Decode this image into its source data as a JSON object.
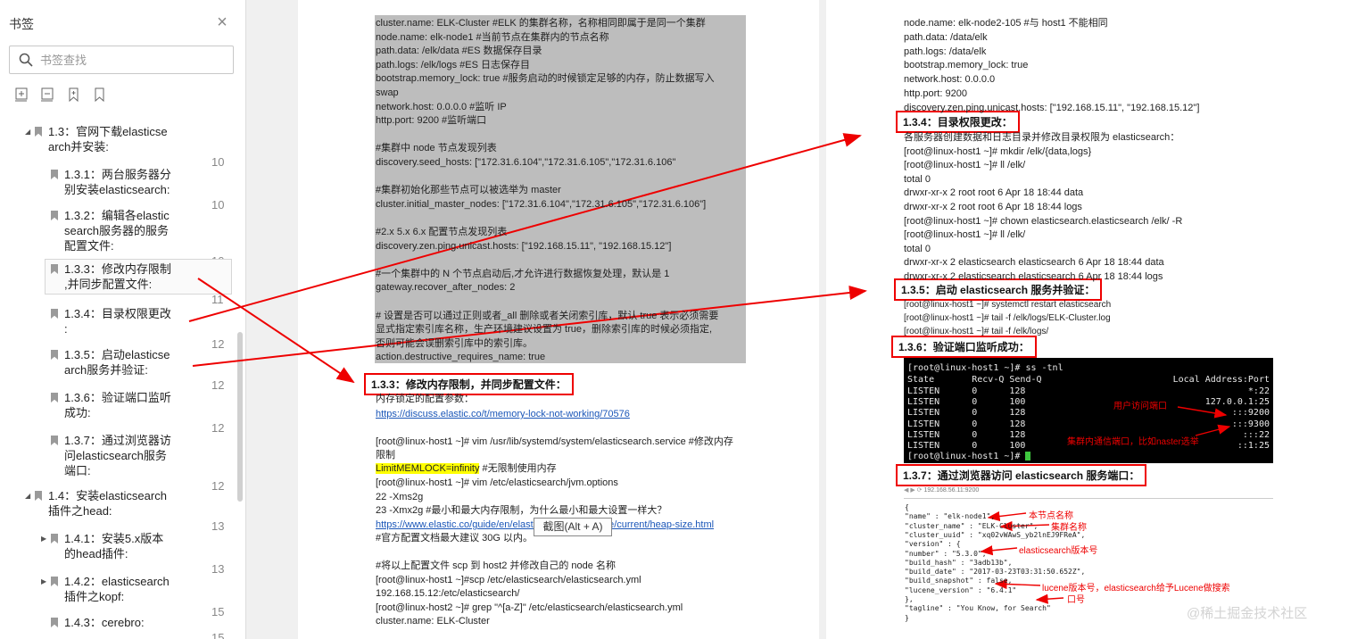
{
  "sidebar": {
    "title": "书签",
    "close_icon": "close-icon",
    "search_placeholder": "书签查找",
    "toolbar_icons": [
      "expand-all-icon",
      "collapse-all-icon",
      "add-bookmark-icon",
      "bookmark-icon"
    ],
    "items": [
      {
        "level": 1,
        "expanded": true,
        "label_lines": [
          "1.3：官网下载elasticse",
          "arch并安装:"
        ],
        "page": "10"
      },
      {
        "level": 2,
        "label_lines": [
          "1.3.1：两台服务器分",
          "别安装elasticsearch:"
        ],
        "page": "10"
      },
      {
        "level": 2,
        "label_lines": [
          "1.3.2：编辑各elastic",
          "search服务器的服务",
          "配置文件:"
        ],
        "page": "10"
      },
      {
        "level": 2,
        "selected": true,
        "label_lines": [
          "1.3.3：修改内存限制",
          ",并同步配置文件:"
        ],
        "page": "11"
      },
      {
        "level": 2,
        "label_lines": [
          "1.3.4：目录权限更改",
          ":"
        ],
        "page": "12"
      },
      {
        "level": 2,
        "label_lines": [
          "1.3.5：启动elasticse",
          "arch服务并验证:"
        ],
        "page": "12"
      },
      {
        "level": 2,
        "label_lines": [
          "1.3.6：验证端口监听",
          "成功:"
        ],
        "page": "12"
      },
      {
        "level": 2,
        "label_lines": [
          "1.3.7：通过浏览器访",
          "问elasticsearch服务",
          "端口:"
        ],
        "page": "12"
      },
      {
        "level": 1,
        "expanded": true,
        "label_lines": [
          "1.4：安装elasticsearch",
          "插件之head:"
        ],
        "page": "13"
      },
      {
        "level": 2,
        "collapsed": true,
        "label_lines": [
          "1.4.1：安装5.x版本",
          "的head插件:"
        ],
        "page": "13"
      },
      {
        "level": 2,
        "collapsed": true,
        "label_lines": [
          "1.4.2：elasticsearch",
          "插件之kopf:"
        ],
        "page": "15"
      },
      {
        "level": 2,
        "label_lines": [
          "1.4.3：cerebro:"
        ],
        "page": "15"
      }
    ]
  },
  "pageA": {
    "gray_lines": [
      "cluster.name: ELK-Cluster #ELK 的集群名称，名称相同即属于是同一个集群",
      "node.name: elk-node1 #当前节点在集群内的节点名称",
      "path.data: /elk/data     #ES 数据保存目录",
      "path.logs: /elk/logs      #ES 日志保存目",
      "bootstrap.memory_lock: true #服务启动的时候锁定足够的内存，防止数据写入",
      "swap",
      "network.host: 0.0.0.0 #监听 IP",
      "http.port: 9200 #监听端口",
      "",
      "#集群中 node 节点发现列表",
      "discovery.seed_hosts: [\"172.31.6.104\",\"172.31.6.105\",\"172.31.6.106\"",
      "",
      "#集群初始化那些节点可以被选举为 master",
      "cluster.initial_master_nodes: [\"172.31.6.104\",\"172.31.6.105\",\"172.31.6.106\"]",
      "",
      "#2.x 5.x 6.x  配置节点发现列表",
      "discovery.zen.ping.unicast.hosts: [\"192.168.15.11\", \"192.168.15.12\"]",
      "",
      "#一个集群中的 N 个节点启动后,才允许进行数据恢复处理，默认是 1",
      "gateway.recover_after_nodes: 2",
      "",
      "# 设置是否可以通过正则或者_all 删除或者关闭索引库，默认 true 表示必须需要",
      "显式指定索引库名称，生产环境建议设置为 true，删除索引库的时候必须指定,",
      "否则可能会误删索引库中的索引库。",
      "action.destructive_requires_name: true"
    ],
    "heading_133": "1.3.3：修改内存限制，并同步配置文件：",
    "memlock_intro": "内存锁定的配置参数：",
    "memlock_link": "https://discuss.elastic.co/t/memory-lock-not-working/70576",
    "vim_cmd_1": "[root@linux-host1 ~]# vim /usr/lib/systemd/system/elasticsearch.service #修改内存",
    "vim_cmd_1b": "限制",
    "limit_hl": "LimitMEMLOCK=infinity",
    "limit_comment": "  #无限制使用内存",
    "vim_cmd_2": "[root@linux-host1 ~]# vim /etc/elasticsearch/jvm.options",
    "xms": "22 -Xms2g",
    "xmx": "23 -Xmx2g #最小和最大内存限制，为什么最小和最大设置一样大？",
    "heap_link": "https://www.elastic.co/guide/en/elasticsearch/reference/current/heap-size.html",
    "heap_comment": "#官方配置文档最大建议 30G 以内。",
    "scp_comment": "#将以上配置文件 scp 到 host2 并修改自己的 node 名称",
    "scp_cmd": "[root@linux-host1 ~]#scp                              /etc/elasticsearch/elasticsearch.yml",
    "scp_dest": "192.168.15.12:/etc/elasticsearch/",
    "grep_cmd": "[root@linux-host2 ~]# grep \"^[a-Z]\" /etc/elasticsearch/elasticsearch.yml",
    "grep_out": "cluster.name: ELK-Cluster",
    "tooltip": "截图(Alt + A)"
  },
  "pageB": {
    "top_lines": [
      "node.name: elk-node2-105     #与 host1 不能相同",
      "path.data: /data/elk",
      "path.logs: /data/elk",
      "bootstrap.memory_lock: true",
      "network.host: 0.0.0.0",
      "http.port: 9200",
      "discovery.zen.ping.unicast.hosts: [\"192.168.15.11\", \"192.168.15.12\"]"
    ],
    "heading_134": "1.3.4：目录权限更改：",
    "perm_lines": [
      "    各服务器创建数据和日志目录并修改目录权限为 elasticsearch：",
      "[root@linux-host1 ~]# mkdir /elk/{data,logs}",
      "[root@linux-host1 ~]# ll /elk/",
      "total 0",
      "drwxr-xr-x 2 root root 6 Apr 18 18:44 data",
      "drwxr-xr-x 2 root root 6 Apr 18 18:44 logs",
      "[root@linux-host1 ~]# chown     elasticsearch.elasticsearch /elk/ -R",
      "[root@linux-host1 ~]# ll /elk/",
      "total 0",
      "drwxr-xr-x 2 elasticsearch elasticsearch 6 Apr 18 18:44 data",
      "drwxr-xr-x 2 elasticsearch elasticsearch 6 Apr 18 18:44 logs"
    ],
    "heading_135": "1.3.5：启动 elasticsearch 服务并验证：",
    "start_lines": [
      "[root@linux-host1 ~]# systemctl    restart elasticsearch",
      "[root@linux-host1 ~]# tail -f /elk/logs/ELK-Cluster.log",
      "[root@linux-host1 ~]# tail -f /elk/logs/"
    ],
    "heading_136": "1.3.6：验证端口监听成功：",
    "terminal": {
      "prompt": "[root@linux-host1 ~]# ss -tnl",
      "header_left": "State       Recv-Q Send-Q",
      "header_right": "Local Address:Port",
      "rows": [
        {
          "left": "LISTEN      0      128",
          "right": "*:22"
        },
        {
          "left": "LISTEN      0      100",
          "right": "127.0.0.1:25"
        },
        {
          "left": "LISTEN      0      128",
          "right": ":::9200"
        },
        {
          "left": "LISTEN      0      128",
          "right": ":::9300"
        },
        {
          "left": "LISTEN      0      128",
          "right": ":::22"
        },
        {
          "left": "LISTEN      0      100",
          "right": "::1:25"
        }
      ],
      "last_prompt": "[root@linux-host1 ~]# ",
      "ann_user": "用户访问端口",
      "ann_cluster": "集群内通信端口，比如naster选举"
    },
    "heading_137": "1.3.7：通过浏览器访问 elasticsearch 服务端口：",
    "browser_url": "192.168.56.11:9200",
    "json_lines": [
      "{",
      "  \"name\" : \"elk-node1\",",
      "  \"cluster_name\" : \"ELK-Cluster\",",
      "  \"cluster_uuid\" : \"xq02vWAwS_yb2lnEJ9FReA\",",
      "  \"version\" : {",
      "    \"number\" : \"5.3.0\",",
      "    \"build_hash\" : \"3adb13b\",",
      "    \"build_date\" : \"2017-03-23T03:31:50.652Z\",",
      "    \"build_snapshot\" : false,",
      "    \"lucene_version\" : \"6.4.1\"",
      "  },",
      "  \"tagline\" : \"You Know, for Search\"",
      "}"
    ],
    "json_ann": {
      "node": "本节点名称",
      "cluster": "集群名称",
      "version": "elasticsearch版本号",
      "lucene": "lucene版本号，elasticsearch给予Lucene做搜索",
      "lucene2": "口号"
    }
  },
  "watermark": "@稀土掘金技术社区",
  "colors": {
    "accent_red": "#e00000",
    "link_blue": "#1a56b8",
    "highlight": "#ffff00",
    "terminal_bg": "#000000"
  }
}
